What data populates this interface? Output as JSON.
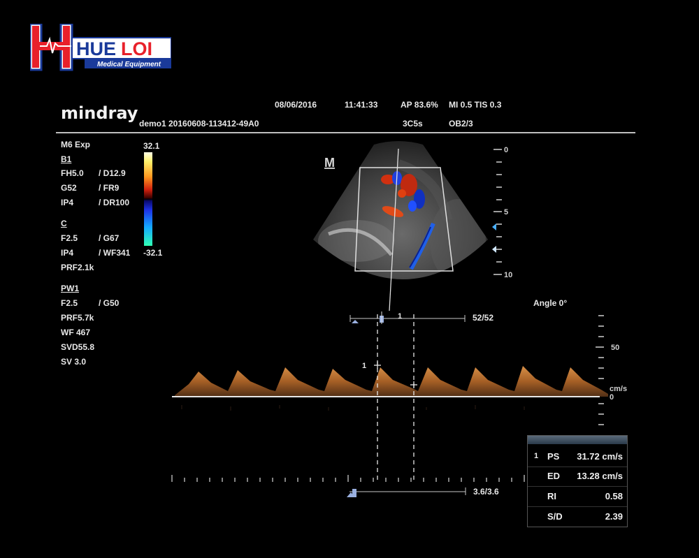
{
  "logo": {
    "text1": "HUE",
    "text2": "LOI",
    "tagline": "Medical Equipment"
  },
  "header": {
    "brand": "mindray",
    "patient_id": "demo1 20160608-113412-49A0",
    "date": "08/06/2016",
    "time": "11:41:33",
    "ap": "AP 83.6%",
    "mi_tis": "MI 0.5 TIS 0.3",
    "probe": "3C5s",
    "preset": "OB2/3"
  },
  "params": {
    "mode": "M6 Exp",
    "b1": {
      "title": "B1",
      "fh": "FH5.0",
      "d": "/ D12.9",
      "g": "G52",
      "fr": "/ FR9",
      "ip": "IP4",
      "dr": "/ DR100"
    },
    "c": {
      "title": "C",
      "f": "F2.5",
      "g": "/ G67",
      "ip": "IP4",
      "wf": "/ WF341",
      "prf": "PRF2.1k"
    },
    "pw1": {
      "title": "PW1",
      "f": "F2.5",
      "g": "/ G50",
      "prf": "PRF5.7k",
      "wf": "WF 467",
      "svd": "SVD55.8",
      "sv": "SV 3.0"
    }
  },
  "colorbar": {
    "max": "32.1",
    "min": "-32.1"
  },
  "image": {
    "marker": "M",
    "depth_ticks": [
      "0",
      "5",
      "10"
    ],
    "angle": "Angle 0°",
    "cine_mark": "1",
    "frame_counter": "52/52",
    "sweep_counter": "3.6/3.6"
  },
  "doppler": {
    "scale_top": "50",
    "unit": "cm/s",
    "baseline": "0",
    "caliper_mark": "1"
  },
  "results": {
    "index": "1",
    "rows": [
      {
        "label": "PS",
        "value": "31.72 cm/s"
      },
      {
        "label": "ED",
        "value": "13.28 cm/s"
      },
      {
        "label": "RI",
        "value": "0.58"
      },
      {
        "label": "S/D",
        "value": "2.39"
      }
    ]
  },
  "colors": {
    "accent_blue": "#1a3a9a",
    "logo_red": "#e8202a",
    "spectrum": "#c9813a"
  }
}
